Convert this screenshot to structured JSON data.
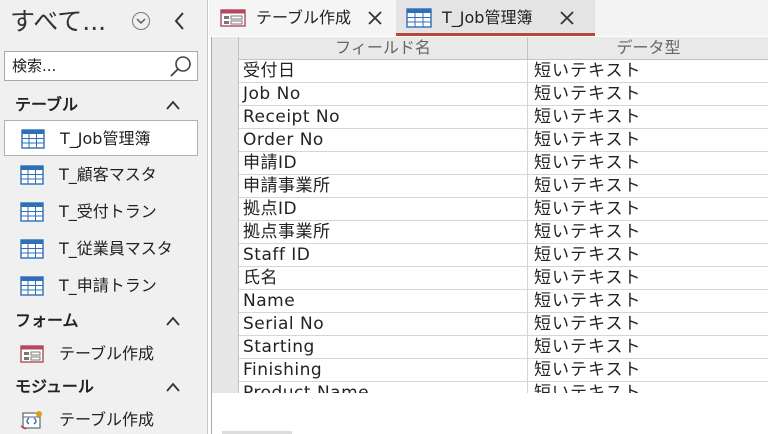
{
  "nav": {
    "title": "すべて...",
    "search": {
      "placeholder": "検索..."
    },
    "groups": [
      {
        "label": "テーブル",
        "items": [
          {
            "label": "T_Job管理簿",
            "icon": "table-icon",
            "selected": true
          },
          {
            "label": "T_顧客マスタ",
            "icon": "table-icon"
          },
          {
            "label": "T_受付トラン",
            "icon": "table-icon"
          },
          {
            "label": "T_従業員マスタ",
            "icon": "table-icon"
          },
          {
            "label": "T_申請トラン",
            "icon": "table-icon"
          }
        ]
      },
      {
        "label": "フォーム",
        "items": [
          {
            "label": "テーブル作成",
            "icon": "form-icon"
          }
        ]
      },
      {
        "label": "モジュール",
        "items": [
          {
            "label": "テーブル作成",
            "icon": "module-icon"
          }
        ]
      }
    ]
  },
  "tabs": [
    {
      "label": "テーブル作成",
      "icon": "form-icon",
      "active": false
    },
    {
      "label": "T_Job管理簿",
      "icon": "table-icon",
      "active": true
    }
  ],
  "grid": {
    "headers": {
      "field_name": "フィールド名",
      "data_type": "データ型"
    },
    "rows": [
      {
        "field": "受付日",
        "type": "短いテキスト"
      },
      {
        "field": "Job No",
        "type": "短いテキスト"
      },
      {
        "field": "Receipt No",
        "type": "短いテキスト"
      },
      {
        "field": "Order No",
        "type": "短いテキスト"
      },
      {
        "field": "申請ID",
        "type": "短いテキスト"
      },
      {
        "field": "申請事業所",
        "type": "短いテキスト"
      },
      {
        "field": "拠点ID",
        "type": "短いテキスト"
      },
      {
        "field": "拠点事業所",
        "type": "短いテキスト"
      },
      {
        "field": "Staff ID",
        "type": "短いテキスト"
      },
      {
        "field": "氏名",
        "type": "短いテキスト"
      },
      {
        "field": "Name",
        "type": "短いテキスト"
      },
      {
        "field": "Serial No",
        "type": "短いテキスト"
      },
      {
        "field": "Starting",
        "type": "短いテキスト"
      },
      {
        "field": "Finishing",
        "type": "短いテキスト"
      },
      {
        "field": "Product Name",
        "type": "短いテキスト"
      }
    ]
  },
  "colors": {
    "accent": "#b7473a",
    "nav_bg": "#f0f0f0",
    "table_icon": "#2f6fb8",
    "form_icon": "#b5485a"
  }
}
